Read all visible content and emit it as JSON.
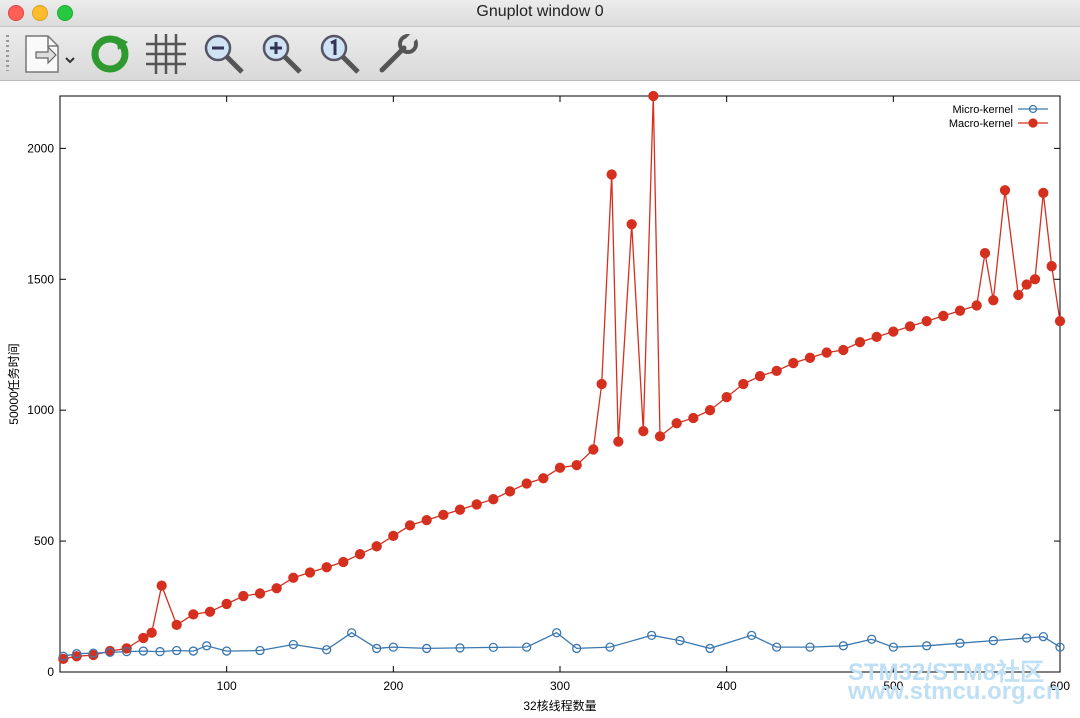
{
  "window": {
    "title": "Gnuplot window 0"
  },
  "toolbar": {
    "icons": [
      "export-icon",
      "replot-icon",
      "grid-icon",
      "zoom-out-icon",
      "zoom-in-icon",
      "zoom-reset-icon",
      "settings-icon"
    ]
  },
  "watermark": {
    "line1": "STM32/STM8社区",
    "line2": "www.stmcu.org.cn"
  },
  "chart_data": {
    "type": "line",
    "title": "",
    "xlabel": "32核线程数量",
    "ylabel": "50000任务时间",
    "xlim": [
      0,
      600
    ],
    "ylim": [
      0,
      2200
    ],
    "xticks": [
      100,
      200,
      300,
      400,
      500,
      600
    ],
    "yticks": [
      0,
      500,
      1000,
      1500,
      2000
    ],
    "grid": false,
    "legend": "top-right",
    "colors": {
      "micro": "#3b78b0",
      "macro": "#d5301f"
    },
    "series": [
      {
        "name": "Micro-kernel",
        "marker": "open-circle",
        "points": [
          [
            2,
            60
          ],
          [
            10,
            70
          ],
          [
            20,
            72
          ],
          [
            30,
            75
          ],
          [
            40,
            78
          ],
          [
            50,
            80
          ],
          [
            60,
            78
          ],
          [
            70,
            82
          ],
          [
            80,
            80
          ],
          [
            88,
            100
          ],
          [
            100,
            80
          ],
          [
            120,
            82
          ],
          [
            140,
            105
          ],
          [
            160,
            85
          ],
          [
            175,
            150
          ],
          [
            190,
            90
          ],
          [
            200,
            95
          ],
          [
            220,
            90
          ],
          [
            240,
            92
          ],
          [
            260,
            94
          ],
          [
            280,
            95
          ],
          [
            298,
            150
          ],
          [
            310,
            90
          ],
          [
            330,
            95
          ],
          [
            355,
            140
          ],
          [
            372,
            120
          ],
          [
            390,
            90
          ],
          [
            415,
            140
          ],
          [
            430,
            95
          ],
          [
            450,
            95
          ],
          [
            470,
            100
          ],
          [
            487,
            125
          ],
          [
            500,
            95
          ],
          [
            520,
            100
          ],
          [
            540,
            110
          ],
          [
            560,
            120
          ],
          [
            580,
            130
          ],
          [
            590,
            135
          ],
          [
            600,
            95
          ]
        ]
      },
      {
        "name": "Macro-kernel",
        "marker": "filled-circle",
        "points": [
          [
            2,
            50
          ],
          [
            10,
            60
          ],
          [
            20,
            65
          ],
          [
            30,
            80
          ],
          [
            40,
            90
          ],
          [
            50,
            130
          ],
          [
            55,
            150
          ],
          [
            61,
            330
          ],
          [
            70,
            180
          ],
          [
            80,
            220
          ],
          [
            90,
            230
          ],
          [
            100,
            260
          ],
          [
            110,
            290
          ],
          [
            120,
            300
          ],
          [
            130,
            320
          ],
          [
            140,
            360
          ],
          [
            150,
            380
          ],
          [
            160,
            400
          ],
          [
            170,
            420
          ],
          [
            180,
            450
          ],
          [
            190,
            480
          ],
          [
            200,
            520
          ],
          [
            210,
            560
          ],
          [
            220,
            580
          ],
          [
            230,
            600
          ],
          [
            240,
            620
          ],
          [
            250,
            640
          ],
          [
            260,
            660
          ],
          [
            270,
            690
          ],
          [
            280,
            720
          ],
          [
            290,
            740
          ],
          [
            300,
            780
          ],
          [
            310,
            790
          ],
          [
            320,
            850
          ],
          [
            325,
            1100
          ],
          [
            331,
            1900
          ],
          [
            335,
            880
          ],
          [
            343,
            1710
          ],
          [
            350,
            920
          ],
          [
            356,
            2200
          ],
          [
            360,
            900
          ],
          [
            370,
            950
          ],
          [
            380,
            970
          ],
          [
            390,
            1000
          ],
          [
            400,
            1050
          ],
          [
            410,
            1100
          ],
          [
            420,
            1130
          ],
          [
            430,
            1150
          ],
          [
            440,
            1180
          ],
          [
            450,
            1200
          ],
          [
            460,
            1220
          ],
          [
            470,
            1230
          ],
          [
            480,
            1260
          ],
          [
            490,
            1280
          ],
          [
            500,
            1300
          ],
          [
            510,
            1320
          ],
          [
            520,
            1340
          ],
          [
            530,
            1360
          ],
          [
            540,
            1380
          ],
          [
            550,
            1400
          ],
          [
            555,
            1600
          ],
          [
            560,
            1420
          ],
          [
            567,
            1840
          ],
          [
            575,
            1440
          ],
          [
            580,
            1480
          ],
          [
            585,
            1500
          ],
          [
            590,
            1830
          ],
          [
            595,
            1550
          ],
          [
            600,
            1340
          ]
        ]
      }
    ]
  }
}
